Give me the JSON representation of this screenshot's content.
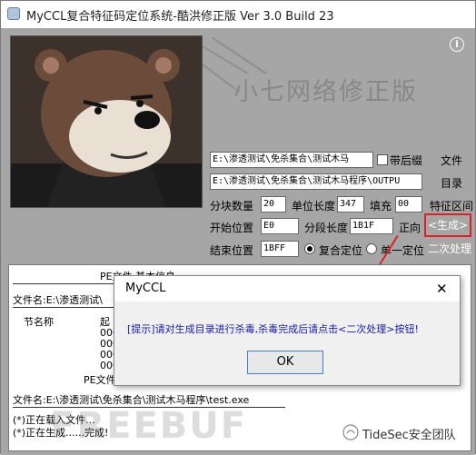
{
  "window": {
    "title": "MyCCL复合特征码定位系统-酷洪修正版  Ver 3.0  Build 23"
  },
  "banner": {
    "title": "小七网络修正版"
  },
  "form": {
    "file_path": "E:\\渗透测试\\免杀集合\\测试木马",
    "check_tail_label": "带后缀",
    "file_button": "文件",
    "dir_path": "E:\\渗透测试\\免杀集合\\测试木马程序\\OUTPU",
    "dir_button": "目录",
    "block_count_label": "分块数量",
    "block_count": "20",
    "unit_length_label": "单位长度",
    "unit_length": "347",
    "fill_label": "填充",
    "fill": "00",
    "feature_range_label": "特征区间",
    "start_pos_label": "开始位置",
    "start_pos": "E0",
    "segment_length_label": "分段长度",
    "segment_length": "1B1F",
    "direction_label": "正向",
    "generate_button": "<生成>",
    "end_pos_label": "结束位置",
    "end_pos": "1BFF",
    "composite_label": "复合定位",
    "single_label": "单一定位",
    "second_process_button": "二次处理"
  },
  "log": {
    "pe_header": "PE文件   基本信息",
    "file_line_1": "文件名:E:\\渗透测试\\",
    "section_name_label": "节名称",
    "col_start_label": "起",
    "zeros": [
      "000",
      "000",
      "000",
      "000"
    ],
    "pe_header_2": "PE文件",
    "file_line_2": "文件名:E:\\渗透测试\\免杀集合\\测试木马程序\\test.exe",
    "status_1": "(*)正在载入文件...",
    "status_2": "(*)正在生成......完成!"
  },
  "dialog": {
    "title": "MyCCL",
    "close": "✕",
    "message": "[提示]请对生成目录进行杀毒,杀毒完成后请点击<二次处理>按钮!",
    "ok_button": "OK"
  },
  "watermark": {
    "brand": "TideSec安全团队",
    "faint": "FREEBUF"
  }
}
